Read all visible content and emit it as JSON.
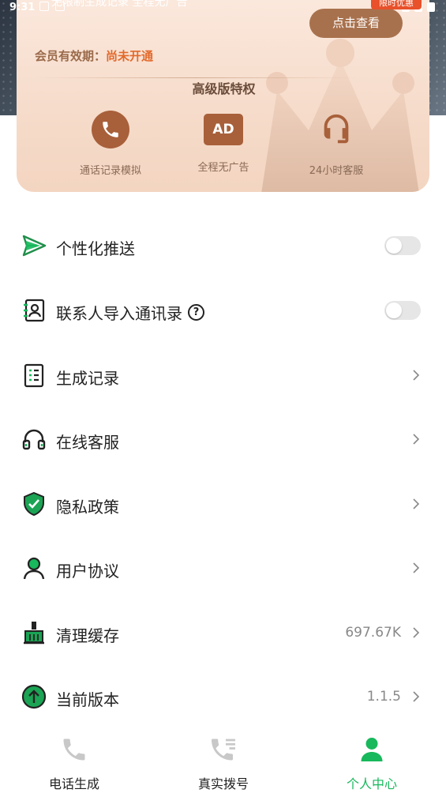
{
  "status_bar": {
    "time": "9:31"
  },
  "header": {
    "promo_tag": "限时优惠",
    "cut_title": "无限制生成记录  全程无广告"
  },
  "vip_card": {
    "view_button": "点击查看",
    "membership_label": "会员有效期：",
    "membership_value": "尚未开通",
    "privileges_title": "高级版特权",
    "privileges": [
      {
        "icon": "phone-icon",
        "label": "通话记录模拟"
      },
      {
        "icon": "ad-icon",
        "label": "全程无广告",
        "badge": "AD"
      },
      {
        "icon": "headset-icon",
        "label": "24小时客服"
      }
    ]
  },
  "settings": [
    {
      "icon": "send-icon",
      "label": "个性化推送",
      "control": "toggle",
      "on": false
    },
    {
      "icon": "contacts-import-icon",
      "label": "联系人导入通讯录",
      "control": "toggle",
      "on": false,
      "help": "?"
    },
    {
      "icon": "records-icon",
      "label": "生成记录",
      "control": "chevron"
    },
    {
      "icon": "headphones-icon",
      "label": "在线客服",
      "control": "chevron"
    },
    {
      "icon": "shield-icon",
      "label": "隐私政策",
      "control": "chevron"
    },
    {
      "icon": "user-icon",
      "label": "用户协议",
      "control": "chevron"
    },
    {
      "icon": "broom-icon",
      "label": "清理缓存",
      "control": "chevron",
      "value": "697.67K"
    },
    {
      "icon": "upgrade-icon",
      "label": "当前版本",
      "control": "chevron",
      "value": "1.1.5"
    }
  ],
  "bottom_nav": [
    {
      "icon": "phone-icon",
      "label": "电话生成",
      "active": false
    },
    {
      "icon": "dial-list-icon",
      "label": "真实拨号",
      "active": false
    },
    {
      "icon": "person-icon",
      "label": "个人中心",
      "active": true
    }
  ],
  "colors": {
    "accent_green": "#18b85c",
    "vip_brown": "#a8603a",
    "vip_orange": "#e2692b"
  }
}
